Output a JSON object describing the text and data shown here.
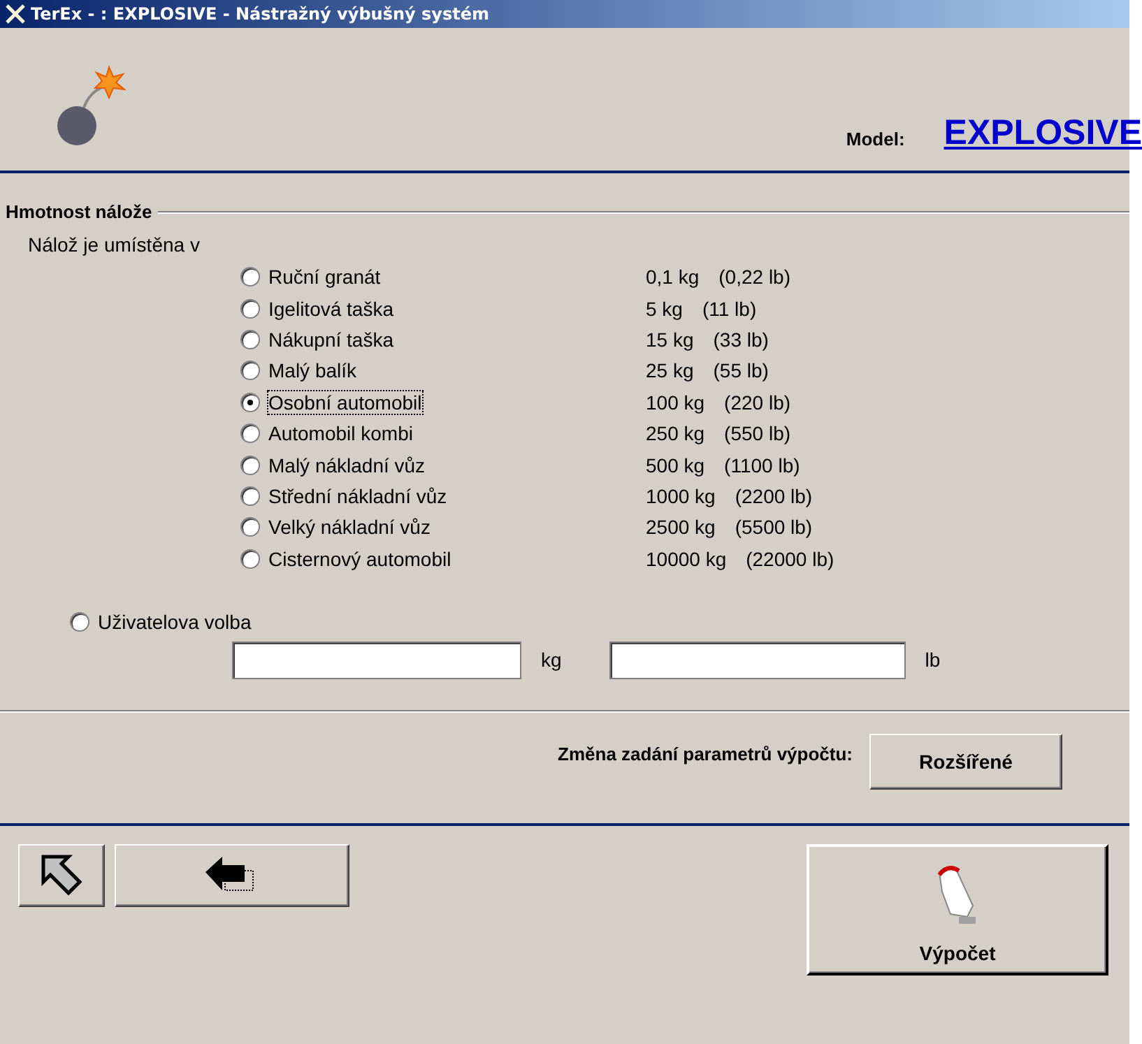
{
  "window": {
    "title": "TerEx - : EXPLOSIVE - Nástražný výbušný systém"
  },
  "header": {
    "model_label": "Model:",
    "model": "EXPLOSIVE"
  },
  "charge": {
    "legend": "Hmotnost nálože",
    "prompt": "Nálož je umístěna v",
    "options": [
      {
        "label": "Ruční granát",
        "kg": "0,1 kg",
        "lb": "(0,22 lb)",
        "selected": false
      },
      {
        "label": "Igelitová taška",
        "kg": "5 kg",
        "lb": "(11 lb)",
        "selected": false
      },
      {
        "label": "Nákupní taška",
        "kg": "15 kg",
        "lb": "(33 lb)",
        "selected": false
      },
      {
        "label": "Malý balík",
        "kg": "25 kg",
        "lb": "(55 lb)",
        "selected": false
      },
      {
        "label": "Osobní automobil",
        "kg": "100 kg",
        "lb": "(220 lb)",
        "selected": true
      },
      {
        "label": "Automobil kombi",
        "kg": "250 kg",
        "lb": "(550 lb)",
        "selected": false
      },
      {
        "label": "Malý nákladní vůz",
        "kg": "500 kg",
        "lb": "(1100 lb)",
        "selected": false
      },
      {
        "label": "Střední nákladní vůz",
        "kg": "1000 kg",
        "lb": "(2200 lb)",
        "selected": false
      },
      {
        "label": "Velký nákladní vůz",
        "kg": "2500 kg",
        "lb": "(5500 lb)",
        "selected": false
      },
      {
        "label": "Cisternový automobil",
        "kg": "10000 kg",
        "lb": "(22000 lb)",
        "selected": false
      }
    ],
    "custom": {
      "label": "Uživatelova volba",
      "selected": false,
      "kg_unit": "kg",
      "lb_unit": "lb"
    }
  },
  "advanced": {
    "label": "Změna zadání parametrů výpočtu:",
    "button": "Rozšířené"
  },
  "footer": {
    "calculate": "Výpočet"
  }
}
